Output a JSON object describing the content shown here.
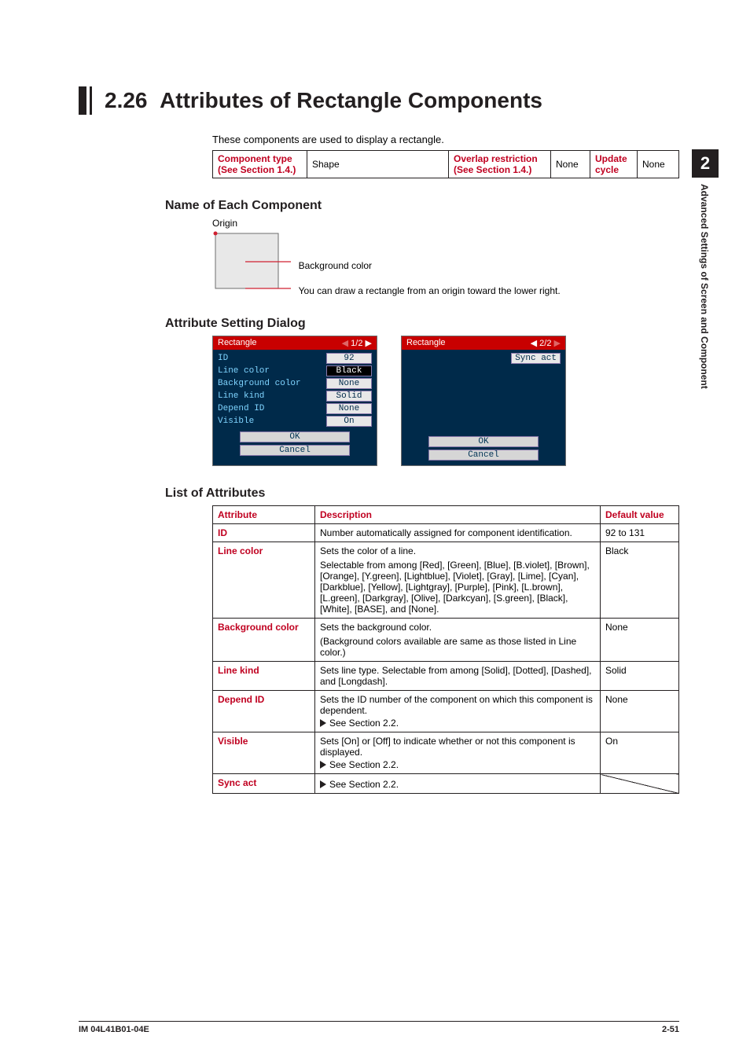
{
  "chapter_tab": {
    "number": "2",
    "label": "Advanced Settings of Screen and Component"
  },
  "section": {
    "number": "2.26",
    "title": "Attributes of Rectangle Components"
  },
  "intro": "These components are used to display a rectangle.",
  "meta": {
    "headers": {
      "component_type": "Component type",
      "see1": "(See Section 1.4.)",
      "overlap": "Overlap restriction",
      "see2": "(See Section 1.4.)",
      "update": "Update cycle"
    },
    "values": {
      "component_type": "Shape",
      "overlap": "None",
      "update": "None"
    }
  },
  "sections": {
    "name": "Name of Each Component",
    "dialog": "Attribute Setting Dialog",
    "list": "List of Attributes"
  },
  "illustration": {
    "origin": "Origin",
    "bg": "Background color",
    "note": "You can draw a rectangle from an origin toward the lower right."
  },
  "dialog1": {
    "title": "Rectangle",
    "page": "1/2",
    "rows": [
      {
        "label": "ID",
        "value": "92"
      },
      {
        "label": "Line color",
        "value": "Black",
        "style": "blk"
      },
      {
        "label": "Background color",
        "value": "None"
      },
      {
        "label": "Line kind",
        "value": "Solid"
      },
      {
        "label": "Depend ID",
        "value": "None"
      },
      {
        "label": "Visible",
        "value": "On"
      }
    ],
    "ok": "OK",
    "cancel": "Cancel"
  },
  "dialog2": {
    "title": "Rectangle",
    "page": "2/2",
    "sync": "Sync act",
    "ok": "OK",
    "cancel": "Cancel"
  },
  "attr_headers": {
    "attr": "Attribute",
    "desc": "Description",
    "def": "Default value"
  },
  "attrs": [
    {
      "name": "ID",
      "desc": [
        "Number automatically assigned for component identification."
      ],
      "def": "92 to 131"
    },
    {
      "name": "Line color",
      "desc": [
        "Sets the color of a line.",
        "Selectable from among [Red], [Green], [Blue], [B.violet], [Brown], [Orange], [Y.green], [Lightblue], [Violet], [Gray], [Lime], [Cyan], [Darkblue], [Yellow], [Lightgray], [Purple], [Pink], [L.brown], [L.green], [Darkgray], [Olive], [Darkcyan], [S.green], [Black], [White], [BASE], and [None]."
      ],
      "def": "Black"
    },
    {
      "name": "Background color",
      "desc": [
        "Sets the background color.",
        "(Background colors available are same as those listed in Line color.)"
      ],
      "def": "None"
    },
    {
      "name": "Line kind",
      "desc": [
        "Sets line type. Selectable from among [Solid], [Dotted], [Dashed], and [Longdash]."
      ],
      "def": "Solid"
    },
    {
      "name": "Depend ID",
      "desc": [
        "Sets the ID number of the component on which this component is dependent."
      ],
      "see": "See Section 2.2.",
      "def": "None"
    },
    {
      "name": "Visible",
      "desc": [
        "Sets [On] or [Off] to indicate whether or not this component is displayed."
      ],
      "see": "See Section 2.2.",
      "def": "On"
    },
    {
      "name": "Sync act",
      "see": "See Section 2.2.",
      "def_diag": true
    }
  ],
  "footer": {
    "left": "IM 04L41B01-04E",
    "right": "2-51"
  }
}
